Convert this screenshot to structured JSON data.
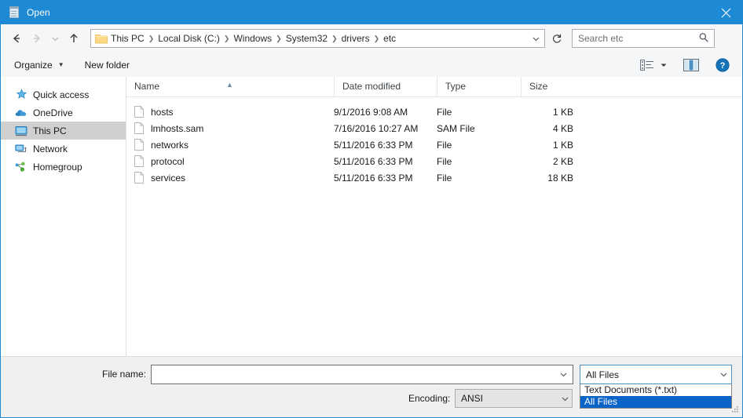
{
  "window": {
    "title": "Open",
    "icon": "notepad-icon",
    "close_label": "✕",
    "accent_color": "#1e8ad6",
    "selection_color": "#0a64c8"
  },
  "nav": {
    "back": "back-arrow",
    "forward": "forward-arrow",
    "recent": "recent-locations-chevron",
    "up": "up-arrow",
    "refresh_title": "Refresh",
    "breadcrumbs": [
      "This PC",
      "Local Disk (C:)",
      "Windows",
      "System32",
      "drivers",
      "etc"
    ],
    "separator": "❯"
  },
  "search": {
    "placeholder": "Search etc",
    "value": "Search etc"
  },
  "toolbar": {
    "organize_label": "Organize",
    "new_folder_label": "New folder",
    "caret": "▼",
    "view_icon": "view-options-icon",
    "preview_pane_icon": "preview-pane-icon",
    "help_icon": "help-icon"
  },
  "sidebar": {
    "items": [
      {
        "label": "Quick access",
        "icon": "star-icon",
        "selected": false
      },
      {
        "label": "OneDrive",
        "icon": "cloud-icon",
        "selected": false
      },
      {
        "label": "This PC",
        "icon": "monitor-icon",
        "selected": true
      },
      {
        "label": "Network",
        "icon": "network-icon",
        "selected": false
      },
      {
        "label": "Homegroup",
        "icon": "homegroup-icon",
        "selected": false
      }
    ]
  },
  "filelist": {
    "columns": [
      "Name",
      "Date modified",
      "Type",
      "Size"
    ],
    "sort_indicator": "▲",
    "rows": [
      {
        "name": "hosts",
        "date": "9/1/2016 9:08 AM",
        "type": "File",
        "size": "1 KB"
      },
      {
        "name": "lmhosts.sam",
        "date": "7/16/2016 10:27 AM",
        "type": "SAM File",
        "size": "4 KB"
      },
      {
        "name": "networks",
        "date": "5/11/2016 6:33 PM",
        "type": "File",
        "size": "1 KB"
      },
      {
        "name": "protocol",
        "date": "5/11/2016 6:33 PM",
        "type": "File",
        "size": "2 KB"
      },
      {
        "name": "services",
        "date": "5/11/2016 6:33 PM",
        "type": "File",
        "size": "18 KB"
      }
    ]
  },
  "bottom": {
    "filename_label": "File name:",
    "filename_value": "",
    "encoding_label": "Encoding:",
    "encoding_value": "ANSI",
    "filter_value": "All Files",
    "filter_options": [
      {
        "label": "Text Documents (*.txt)",
        "selected": false
      },
      {
        "label": "All Files",
        "selected": true
      }
    ]
  }
}
